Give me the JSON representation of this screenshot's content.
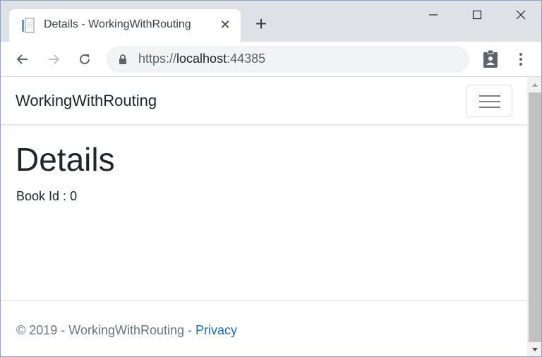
{
  "browser": {
    "tab_title": "Details - WorkingWithRouting",
    "url_prefix": "https://",
    "url_host": "localhost",
    "url_port": ":44385"
  },
  "page": {
    "brand": "WorkingWithRouting",
    "heading": "Details",
    "book_label": "Book Id",
    "book_separator": " : ",
    "book_id": "0"
  },
  "footer": {
    "copyright": "© 2019 - WorkingWithRouting - ",
    "privacy_link": "Privacy"
  },
  "colors": {
    "link": "#1b6ec2",
    "tabstrip": "#dee1e6",
    "omnibox": "#f1f3f4"
  }
}
